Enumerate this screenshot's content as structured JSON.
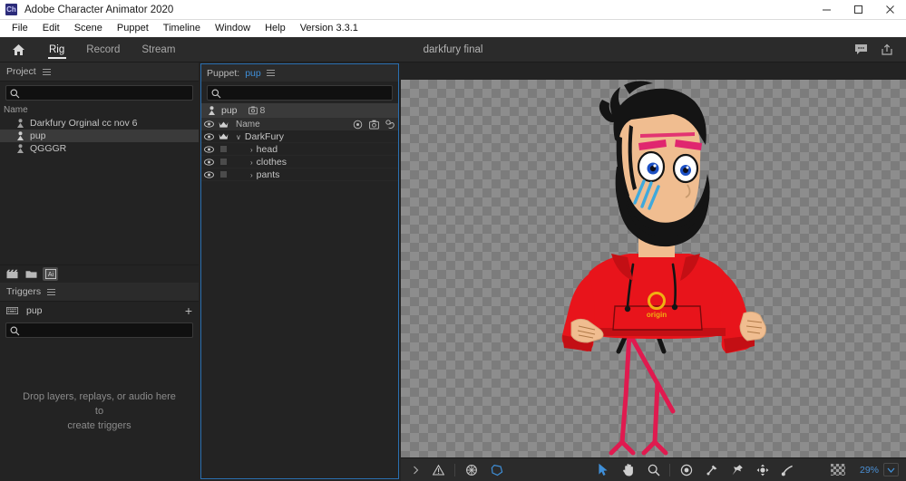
{
  "window": {
    "app_title": "Adobe Character Animator 2020",
    "logo_text": "Ch",
    "minimize_label": "Minimize",
    "maximize_label": "Maximize",
    "close_label": "Close"
  },
  "menubar": {
    "items": [
      {
        "label": "File"
      },
      {
        "label": "Edit"
      },
      {
        "label": "Scene"
      },
      {
        "label": "Puppet"
      },
      {
        "label": "Timeline"
      },
      {
        "label": "Window"
      },
      {
        "label": "Help"
      },
      {
        "label": "Version 3.3.1"
      }
    ]
  },
  "modebar": {
    "home_icon": "home-icon",
    "tabs": [
      {
        "label": "Rig",
        "active": true
      },
      {
        "label": "Record",
        "active": false
      },
      {
        "label": "Stream",
        "active": false
      }
    ],
    "document_title": "darkfury final",
    "right_icons": [
      {
        "name": "comment-icon"
      },
      {
        "name": "share-icon"
      }
    ]
  },
  "project_panel": {
    "title": "Project",
    "menu_icon": "hamburger-icon",
    "search": {
      "value": "",
      "placeholder": ""
    },
    "column_header": "Name",
    "items": [
      {
        "label": "Darkfury Orginal cc nov 6",
        "selected": false
      },
      {
        "label": "pup",
        "selected": true
      },
      {
        "label": "QGGGR",
        "selected": false
      }
    ],
    "footer_buttons": [
      {
        "name": "new-scene-icon",
        "label": "New Scene"
      },
      {
        "name": "new-folder-icon",
        "label": "New Folder"
      },
      {
        "name": "import-ai-icon",
        "label": "Ai"
      }
    ]
  },
  "triggers_panel": {
    "title": "Triggers",
    "menu_icon": "hamburger-icon",
    "puppet_name": "pup",
    "add_label": "+",
    "search": {
      "value": "",
      "placeholder": ""
    },
    "empty_text_line1": "Drop layers, replays, or audio here to",
    "empty_text_line2": "create triggers"
  },
  "puppet_panel": {
    "title_label": "Puppet:",
    "title_value": "pup",
    "menu_icon": "hamburger-icon",
    "search": {
      "value": "",
      "placeholder": ""
    },
    "breadcrumb": {
      "name": "pup",
      "count": "8",
      "count_icon": "tag-icon"
    },
    "tree_header": {
      "name_col": "Name",
      "icons": [
        {
          "name": "origin-target-icon"
        },
        {
          "name": "tag-icon"
        },
        {
          "name": "handle-grab-icon"
        }
      ]
    },
    "tree_rows": [
      {
        "label": "DarkFury",
        "depth": 0,
        "expanded": true,
        "chevron": "∨",
        "crown": true,
        "visible": true
      },
      {
        "label": "head",
        "depth": 1,
        "expanded": false,
        "chevron": "›",
        "crown": false,
        "visible": true
      },
      {
        "label": "clothes",
        "depth": 1,
        "expanded": false,
        "chevron": "›",
        "crown": false,
        "visible": true
      },
      {
        "label": "pants",
        "depth": 1,
        "expanded": false,
        "chevron": "›",
        "crown": false,
        "visible": true
      }
    ]
  },
  "canvas": {
    "artwork_name": "DarkFury puppet",
    "origin_label": "origin",
    "hoodie_text": "origin",
    "colors": {
      "hoodie": "#e8141b",
      "hoodie_dark": "#c30f14",
      "skin": "#f0bd90",
      "hair": "#1a1a1a",
      "beard": "#1a1a1a",
      "tear": "#3fa9dc",
      "eyebrow": "#e0266f",
      "limbs": "#e01a4f",
      "shoe_blue": "#1a9ad8",
      "shoe_dark": "#1a1a2a",
      "checker_light": "#8d8d8d",
      "checker_dark": "#7c7c7c"
    }
  },
  "bottom_toolbar": {
    "left_icons": [
      {
        "name": "chevron-right-icon"
      },
      {
        "name": "warning-icon"
      },
      {
        "name": "origin-target-icon"
      },
      {
        "name": "mesh-polygon-icon"
      }
    ],
    "tool_icons": [
      {
        "name": "select-arrow-tool",
        "active": true
      },
      {
        "name": "hand-tool",
        "active": false
      },
      {
        "name": "zoom-tool",
        "active": false
      },
      {
        "name": "origin-tool",
        "active": false
      },
      {
        "name": "dangle-tool",
        "active": false
      },
      {
        "name": "pin-tool",
        "active": false
      },
      {
        "name": "draggable-tool",
        "active": false
      },
      {
        "name": "stick-tool",
        "active": false
      }
    ],
    "transparency_toggle": "transparency-grid-icon",
    "zoom_level": "29%",
    "zoom_dropdown_icon": "chevron-down-icon"
  }
}
